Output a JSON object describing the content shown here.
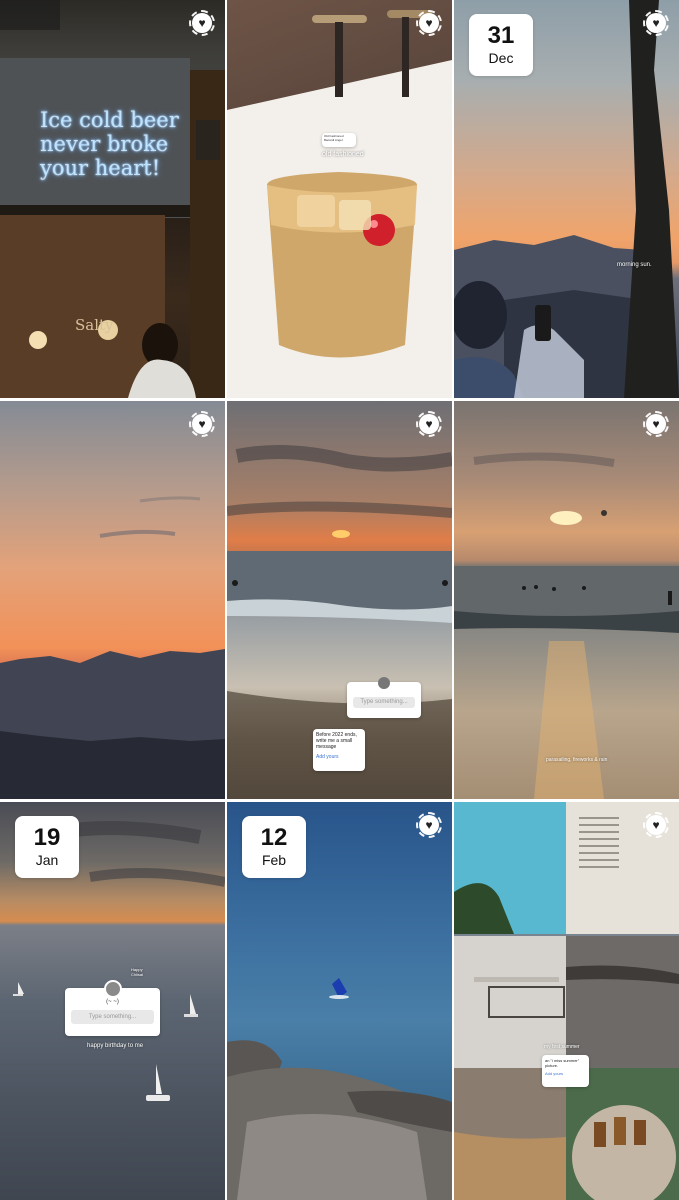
{
  "tiles": [
    {
      "id": "neon-bar",
      "neon_lines": [
        "Ice cold beer",
        "never broke",
        "your heart!"
      ],
      "sign_text": "Salty"
    },
    {
      "id": "cocktail",
      "caption": "old fashioned",
      "tag_line1": "Old Fashioned",
      "tag_line2": "Bacardi Angel"
    },
    {
      "id": "sunrise-phone",
      "date_day": "31",
      "date_month": "Dec",
      "caption": "morning sun."
    },
    {
      "id": "mountain-sunset"
    },
    {
      "id": "beach-sunset-questions",
      "question_placeholder": "Type something...",
      "addyours_prompt": "Before 2022 ends, write me a small message",
      "addyours_action": "Add yours"
    },
    {
      "id": "sea-sunset-parasail",
      "caption": "parasailing, fireworks & rain"
    },
    {
      "id": "sea-sailboats",
      "date_day": "19",
      "date_month": "Jan",
      "question_title": "(~ ~)",
      "question_placeholder": "Type something...",
      "caption": "happy birthday to me",
      "sticker_label": "Happy Chiisai"
    },
    {
      "id": "sea-swimmer",
      "date_day": "12",
      "date_month": "Feb"
    },
    {
      "id": "collage",
      "caption": "my first summer",
      "addyours_prompt": "an \"i miss summer\" picture.",
      "addyours_action": "Add yours"
    }
  ],
  "icons": {
    "save": "heart-icon"
  },
  "colors": {
    "badge_bg": "#ffffff",
    "heart_ring": "#ffffff"
  }
}
